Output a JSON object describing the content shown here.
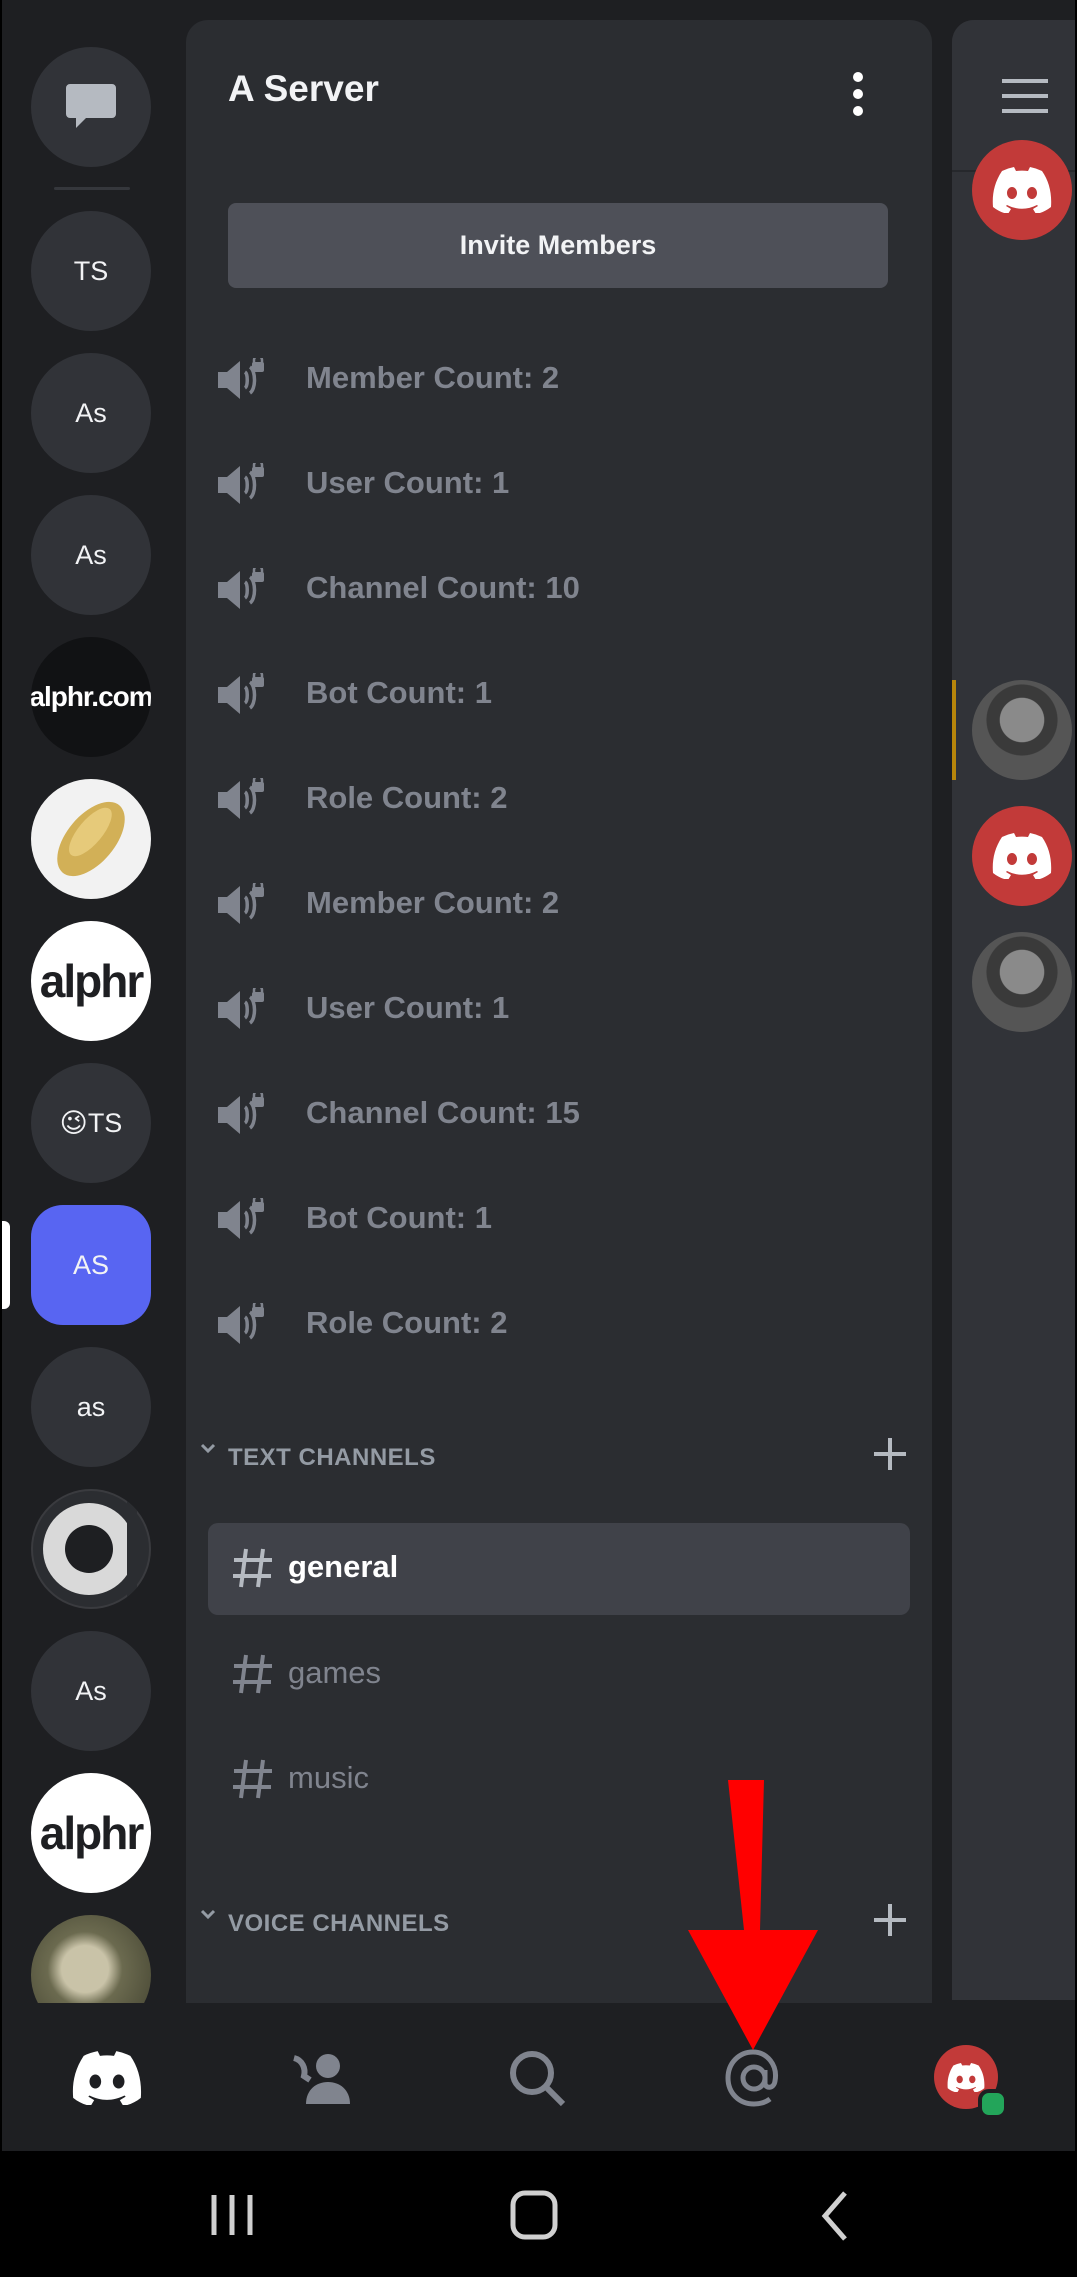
{
  "servers": [
    {
      "label": "TS"
    },
    {
      "label": "As"
    },
    {
      "label": "As"
    },
    {
      "label": "alphr.com"
    },
    {
      "label": ""
    },
    {
      "label": "alphr"
    },
    {
      "label": "😉TS"
    },
    {
      "label": "AS"
    },
    {
      "label": "as"
    },
    {
      "label": ""
    },
    {
      "label": "As"
    },
    {
      "label": "alphr"
    },
    {
      "label": ""
    }
  ],
  "panel": {
    "server_name": "A Server",
    "invite_label": "Invite Members",
    "voice_stats": [
      "Member Count: 2",
      "User Count: 1",
      "Channel Count: 10",
      "Bot Count: 1",
      "Role Count: 2",
      "Member Count: 2",
      "User Count: 1",
      "Channel Count: 15",
      "Bot Count: 1",
      "Role Count: 2"
    ],
    "text_category": "TEXT CHANNELS",
    "text_channels": [
      "general",
      "games",
      "music"
    ],
    "voice_category": "VOICE CHANNELS"
  },
  "colors": {
    "accent": "#5865f2",
    "panel": "#2b2d31",
    "rail": "#1e1f22",
    "selected_channel": "#404249",
    "annotation_arrow": "#ff0000",
    "status_online": "#23a55a"
  },
  "icons": {
    "dm": "chat-bubble-icon",
    "home": "discord-logo-icon",
    "friends": "friends-icon",
    "search": "search-icon",
    "mentions": "at-sign-icon",
    "profile": "avatar-icon",
    "menu": "hamburger-icon"
  }
}
